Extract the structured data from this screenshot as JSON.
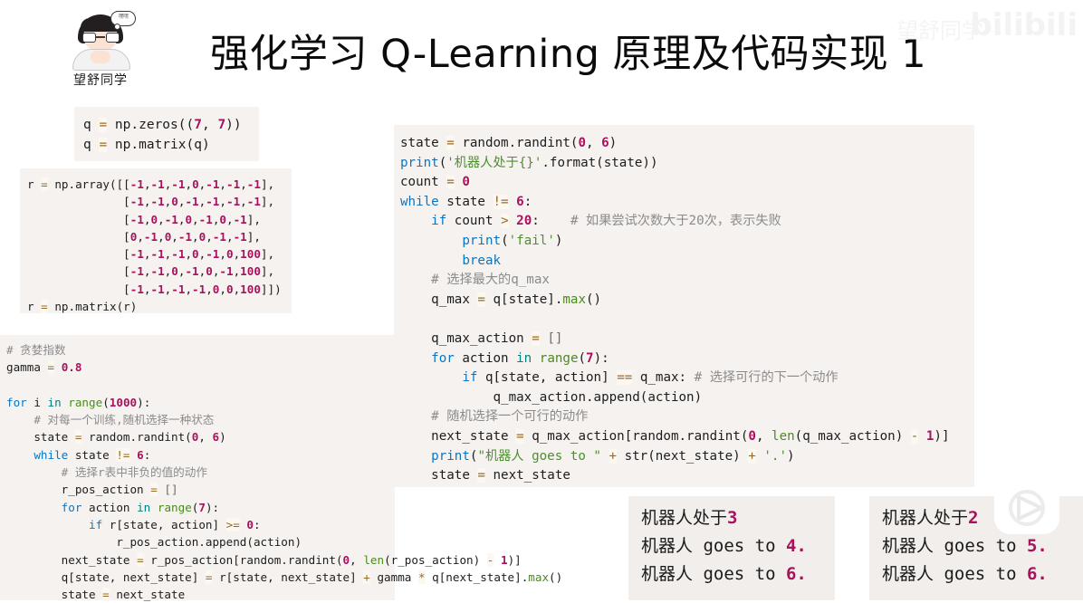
{
  "header": {
    "avatar_name": "望舒同学",
    "avatar_bubble": "嘿嘿",
    "title": "强化学习 Q-Learning 原理及代码实现 1"
  },
  "watermark": {
    "brand": "bilibili",
    "nickname": "望舒同学",
    "tv_logo": "bilibili-tv-logo"
  },
  "code_blocks": {
    "q_init": {
      "name": "q-matrix-init",
      "lines": [
        "q = np.zeros((7, 7))",
        "q = np.matrix(q)"
      ]
    },
    "r_matrix": {
      "name": "reward-matrix",
      "lines": [
        "r = np.array([[-1,-1,-1,0,-1,-1,-1],",
        "              [-1,-1,0,-1,-1,-1,-1],",
        "              [-1,0,-1,0,-1,0,-1],",
        "              [0,-1,0,-1,0,-1,-1],",
        "              [-1,-1,-1,0,-1,0,100],",
        "              [-1,-1,0,-1,0,-1,100],",
        "              [-1,-1,-1,-1,0,0,100]])",
        "r = np.matrix(r)"
      ]
    },
    "training": {
      "name": "training-loop",
      "lines": [
        "# 贪婪指数",
        "gamma = 0.8",
        "",
        "for i in range(1000):",
        "    # 对每一个训练,随机选择一种状态",
        "    state = random.randint(0, 6)",
        "    while state != 6:",
        "        # 选择r表中非负的值的动作",
        "        r_pos_action = []",
        "        for action in range(7):",
        "            if r[state, action] >= 0:",
        "                r_pos_action.append(action)",
        "        next_state = r_pos_action[random.randint(0, len(r_pos_action) - 1)]",
        "        q[state, next_state] = r[state, next_state] + gamma * q[next_state].max()",
        "        state = next_state"
      ]
    },
    "inference": {
      "name": "inference-loop",
      "lines": [
        "state = random.randint(0, 6)",
        "print('机器人处于{}'.format(state))",
        "count = 0",
        "while state != 6:",
        "    if count > 20:    # 如果尝试次数大于20次，表示失败",
        "        print('fail')",
        "        break",
        "    # 选择最大的q_max",
        "    q_max = q[state].max()",
        "",
        "    q_max_action = []",
        "    for action in range(7):",
        "        if q[state, action] == q_max: # 选择可行的下一个动作",
        "            q_max_action.append(action)",
        "    # 随机选择一个可行的动作",
        "    next_state = q_max_action[random.randint(0, len(q_max_action) - 1)]",
        "    print(\"机器人 goes to \" + str(next_state) + '.')",
        "    state = next_state"
      ]
    }
  },
  "outputs": {
    "left": {
      "name": "console-output-run-1",
      "lines": [
        {
          "text": "机器人处于",
          "value": "3"
        },
        {
          "text": "机器人 goes to ",
          "value": "4."
        },
        {
          "text": "机器人 goes to ",
          "value": "6."
        }
      ]
    },
    "right": {
      "name": "console-output-run-2",
      "lines": [
        {
          "text": "机器人处于",
          "value": "2"
        },
        {
          "text": "机器人 goes to ",
          "value": "5."
        },
        {
          "text": "机器人 goes to ",
          "value": "6."
        }
      ]
    }
  },
  "colors": {
    "code_background": "#f5f2f0",
    "output_background": "#f1eeeb",
    "keyword": "#0a76c2",
    "number": "#a8125c",
    "string": "#4e8f2f",
    "comment": "#8b8b8b",
    "page_background": "#ffffff"
  }
}
